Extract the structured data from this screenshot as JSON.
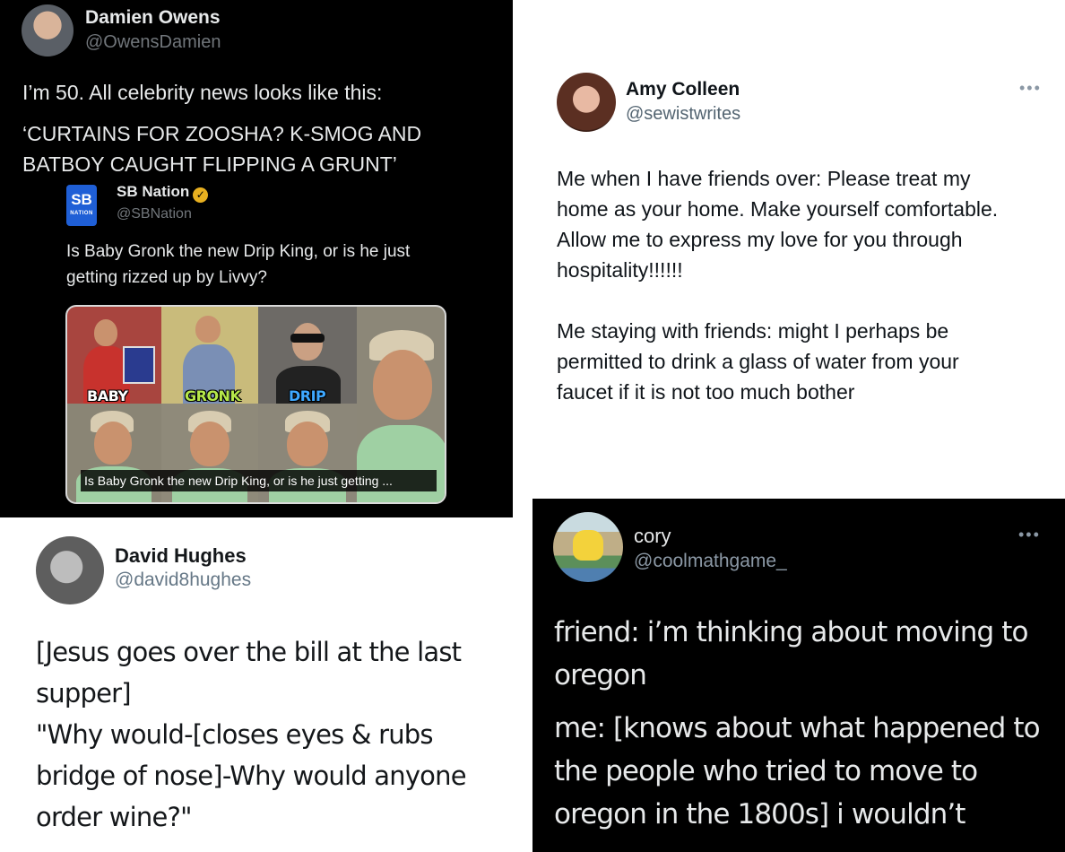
{
  "tweets": {
    "damien": {
      "name": "Damien Owens",
      "handle": "@OwensDamien",
      "text": [
        "I’m 50. All celebrity news looks like this:",
        "‘CURTAINS FOR ZOOSHA? K-SMOG AND",
        "BATBOY CAUGHT FLIPPING A GRUNT’"
      ],
      "quote": {
        "logo_text": "SB",
        "logo_subtext": "NATION",
        "name": "SB Nation",
        "verified_icon": "verified-badge-icon",
        "handle": "@SBNation",
        "text": [
          "Is Baby Gronk the new Drip King, or is he just",
          "getting rizzed up by Livvy?"
        ],
        "media": {
          "labels": [
            "BABY",
            "GRONK",
            "DRIP"
          ],
          "caption": "Is Baby Gronk the new Drip King, or is he just getting ..."
        }
      }
    },
    "amy": {
      "name": "Amy Colleen",
      "handle": "@sewistwrites",
      "more_icon": "more-options-icon",
      "text": [
        "Me when I have friends over: Please treat my",
        "home as your home. Make yourself comfortable.",
        "Allow me to express my love for you through",
        "hospitality!!!!!!",
        "Me staying with friends: might I perhaps be",
        "permitted to drink a glass of water from your",
        "faucet if it is not too much bother"
      ]
    },
    "david": {
      "name": "David Hughes",
      "handle": "@david8hughes",
      "text": [
        "[Jesus goes over the bill at the last",
        "supper]",
        "\"Why would-[closes eyes & rubs",
        "bridge of nose]-Why would anyone",
        "order wine?\""
      ]
    },
    "cory": {
      "name": "cory",
      "handle": "@coolmathgame_",
      "more_icon": "more-options-icon",
      "text": [
        "friend: i’m thinking about moving to",
        "oregon",
        "me: [knows about what happened to",
        "the people who tried to move to",
        "oregon in the 1800s] i wouldn’t"
      ]
    }
  },
  "colors": {
    "dark_bg": "#000000",
    "light_bg": "#ffffff",
    "dark_text": "#e7e9ea",
    "muted_dark": "#71767b",
    "muted_light": "#536471",
    "sb_blue": "#1f5fd6"
  }
}
